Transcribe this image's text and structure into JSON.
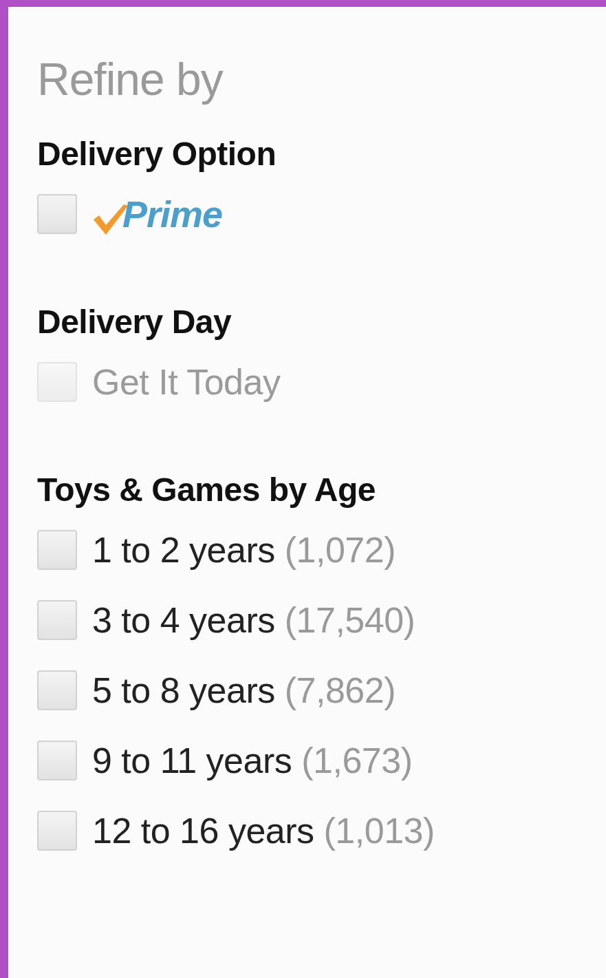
{
  "title": "Refine by",
  "sections": [
    {
      "heading": "Delivery Option",
      "options": [
        {
          "kind": "logo",
          "label": "Prime",
          "checked": false,
          "disabled": false
        }
      ]
    },
    {
      "heading": "Delivery Day",
      "options": [
        {
          "kind": "text",
          "label": "Get It Today",
          "checked": false,
          "disabled": true
        }
      ]
    },
    {
      "heading": "Toys & Games by Age",
      "options": [
        {
          "kind": "text",
          "label": "1 to 2 years",
          "count": "(1,072)",
          "checked": false,
          "disabled": false
        },
        {
          "kind": "text",
          "label": "3 to 4 years",
          "count": "(17,540)",
          "checked": false,
          "disabled": false
        },
        {
          "kind": "text",
          "label": "5 to 8 years",
          "count": "(7,862)",
          "checked": false,
          "disabled": false
        },
        {
          "kind": "text",
          "label": "9 to 11 years",
          "count": "(1,673)",
          "checked": false,
          "disabled": false
        },
        {
          "kind": "text",
          "label": "12 to 16 years",
          "count": "(1,013)",
          "checked": false,
          "disabled": false
        }
      ]
    }
  ]
}
